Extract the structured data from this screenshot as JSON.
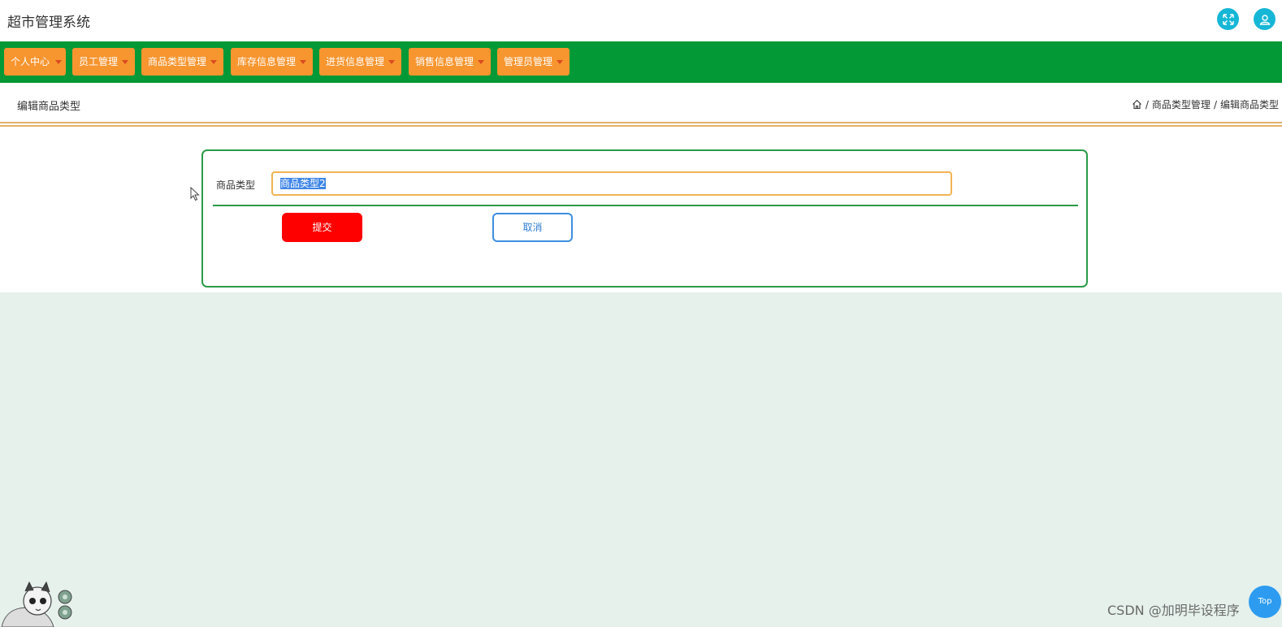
{
  "app": {
    "title": "超市管理系统"
  },
  "nav": {
    "items": [
      {
        "label": "个人中心"
      },
      {
        "label": "员工管理"
      },
      {
        "label": "商品类型管理"
      },
      {
        "label": "库存信息管理"
      },
      {
        "label": "进货信息管理"
      },
      {
        "label": "销售信息管理"
      },
      {
        "label": "管理员管理"
      }
    ]
  },
  "page": {
    "title": "编辑商品类型",
    "breadcrumb": [
      "商品类型管理",
      "编辑商品类型"
    ],
    "breadcrumb_separator": "/"
  },
  "form": {
    "field_label": "商品类型",
    "field_value": "商品类型2",
    "submit_label": "提交",
    "cancel_label": "取消"
  },
  "overlay": {
    "watermark": "CSDN @加明毕设程序",
    "back_to_top": "Top"
  },
  "colors": {
    "nav_bar": "#039936",
    "nav_item": "#f7952f",
    "submit": "#ff0000",
    "form_border": "#2b9a47",
    "page_bg": "#e6f1ec"
  }
}
